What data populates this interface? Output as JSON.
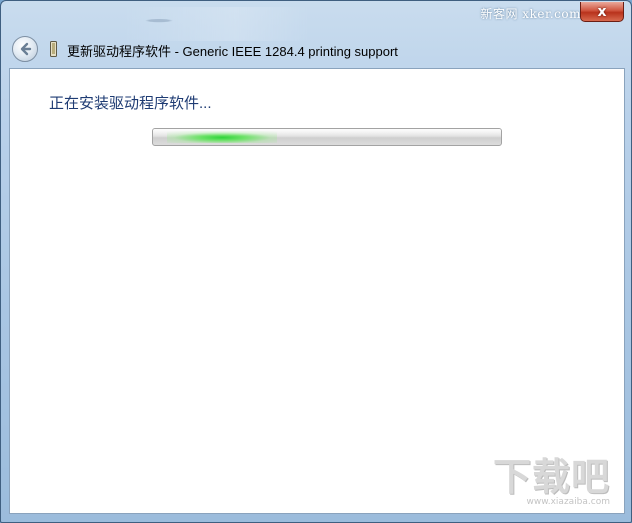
{
  "window": {
    "title": "更新驱动程序软件 - Generic IEEE 1284.4 printing support",
    "close_symbol": "x",
    "top_watermark": "新客网 xker.com"
  },
  "content": {
    "status_text": "正在安装驱动程序软件...",
    "progress": {
      "state": "indeterminate",
      "accent_color": "#2fd43a"
    }
  },
  "watermark": {
    "logo": "下载吧",
    "url": "www.xiazaiba.com"
  },
  "icons": {
    "back": "back-arrow-icon",
    "driver": "device-driver-icon",
    "close": "close-icon"
  }
}
